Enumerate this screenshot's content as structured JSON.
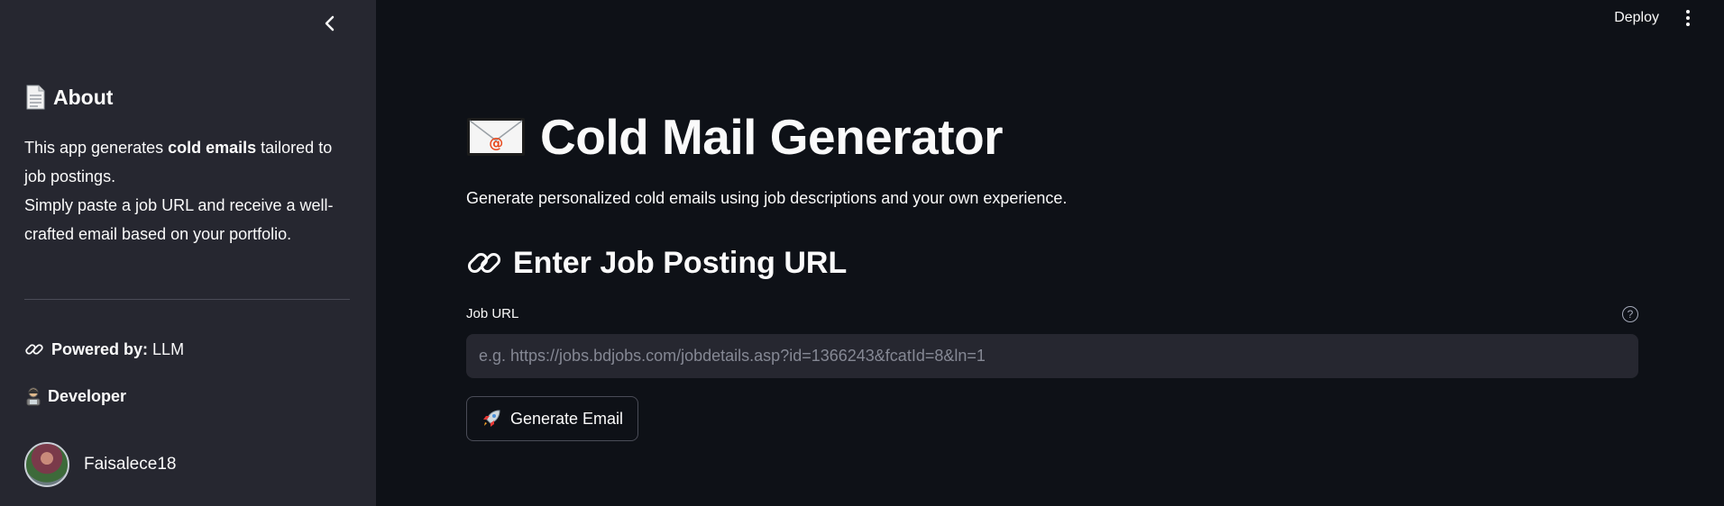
{
  "sidebar": {
    "about_title": "About",
    "about_intro": "This app generates ",
    "about_bold": "cold emails",
    "about_rest": " tailored to job postings.",
    "about_line2": "Simply paste a job URL and receive a well-crafted email based on your portfolio.",
    "powered_label": "Powered by:",
    "powered_value": "LLM",
    "developer_title": "Developer",
    "developer_name": "Faisalece18"
  },
  "header": {
    "deploy_label": "Deploy"
  },
  "main": {
    "title": "Cold Mail Generator",
    "subtitle": "Generate personalized cold emails using job descriptions and your own experience.",
    "section_title": "Enter Job Posting URL",
    "field_label": "Job URL",
    "input_placeholder": "e.g. https://jobs.bdjobs.com/jobdetails.asp?id=1366243&fcatId=8&ln=1",
    "input_value": "",
    "button_label": "Generate Email"
  },
  "icons": {
    "about": "document-icon",
    "powered": "link-icon",
    "developer": "developer-icon",
    "title": "envelope-icon",
    "section": "link-icon",
    "button": "rocket-icon"
  },
  "colors": {
    "background": "#0e1117",
    "sidebar": "#262730",
    "input_bg": "#262730",
    "text": "#fafafa"
  }
}
